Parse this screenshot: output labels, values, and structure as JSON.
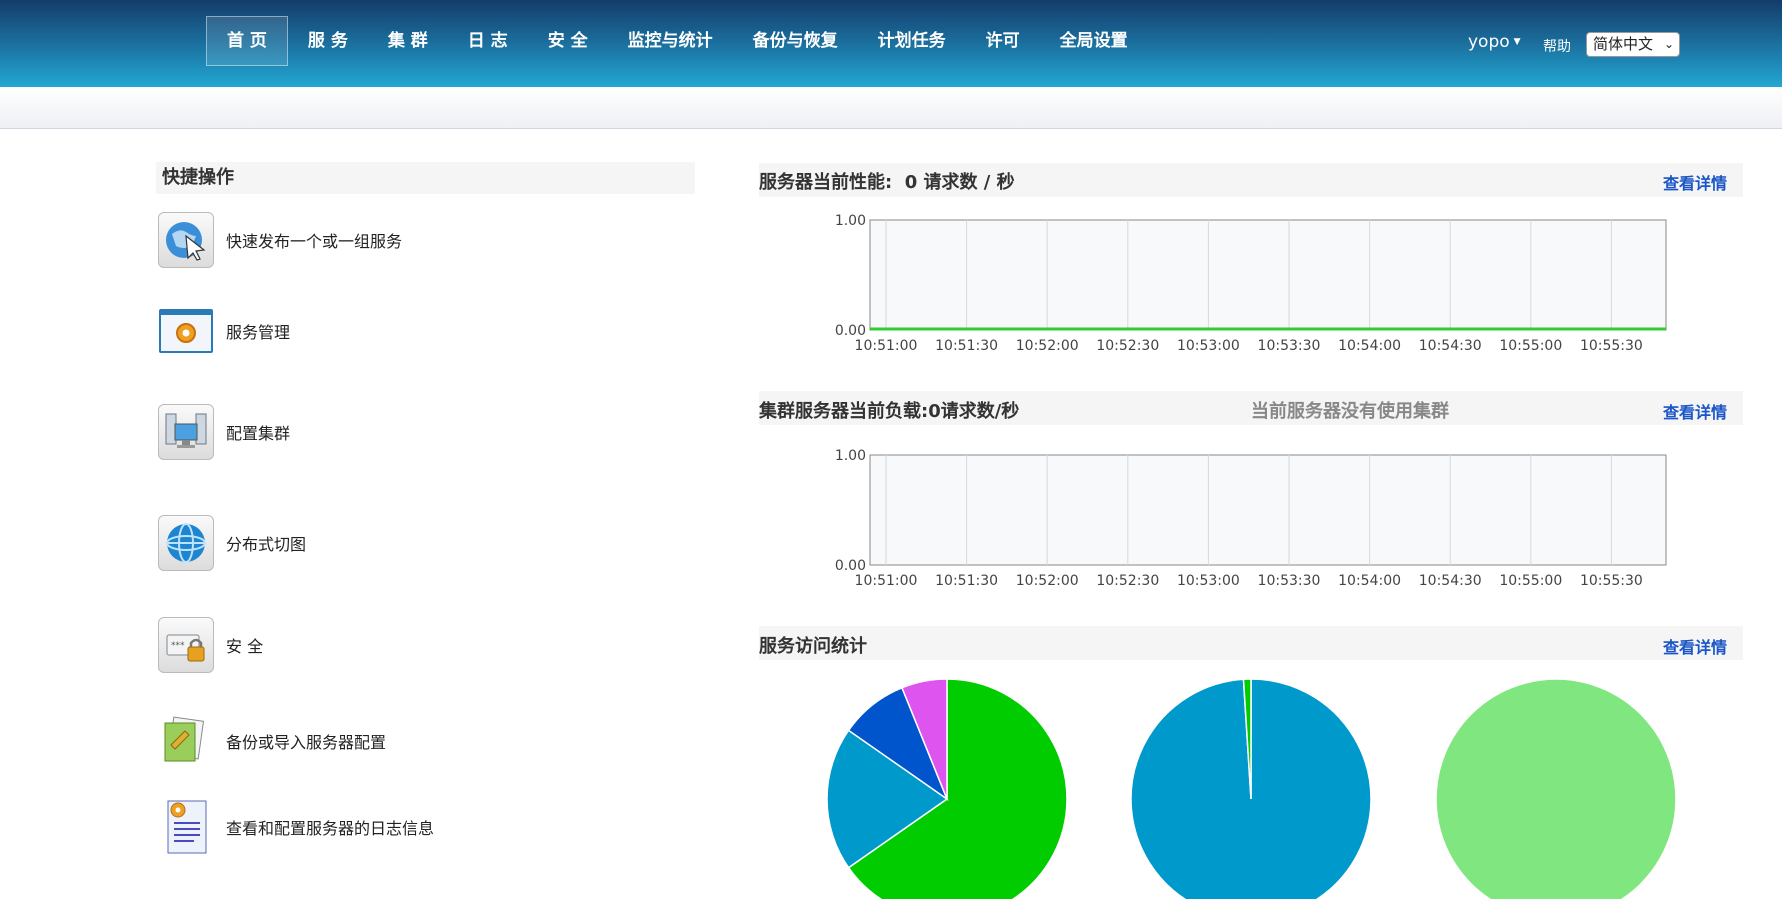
{
  "nav": {
    "items": [
      "首 页",
      "服 务",
      "集 群",
      "日 志",
      "安 全",
      "监控与统计",
      "备份与恢复",
      "计划任务",
      "许可",
      "全局设置"
    ],
    "active": 0
  },
  "header": {
    "user": "yopo",
    "help": "帮助",
    "language": "简体中文"
  },
  "quick_actions": {
    "title": "快捷操作",
    "items": [
      {
        "label": "快速发布一个或一组服务",
        "icon": "globe-cursor-icon"
      },
      {
        "label": "服务管理",
        "icon": "service-gear-icon"
      },
      {
        "label": "配置集群",
        "icon": "cluster-servers-icon"
      },
      {
        "label": "分布式切图",
        "icon": "globe-network-icon"
      },
      {
        "label": "安 全",
        "icon": "lock-icon"
      },
      {
        "label": "备份或导入服务器配置",
        "icon": "backup-tools-icon"
      },
      {
        "label": "查看和配置服务器的日志信息",
        "icon": "log-document-icon"
      }
    ]
  },
  "perf": {
    "title": "服务器当前性能:",
    "value": "0 请求数 / 秒",
    "details": "查看详情"
  },
  "cluster": {
    "title": "集群服务器当前负载:",
    "value": "0请求数/秒",
    "note": "当前服务器没有使用集群",
    "details": "查看详情"
  },
  "access": {
    "title": "服务访问统计",
    "details": "查看详情"
  },
  "chart_data": [
    {
      "type": "line",
      "x": [
        "10:51:00",
        "10:51:30",
        "10:52:00",
        "10:52:30",
        "10:53:00",
        "10:53:30",
        "10:54:00",
        "10:54:30",
        "10:55:00",
        "10:55:30"
      ],
      "series": [
        {
          "values": [
            0,
            0,
            0,
            0,
            0,
            0,
            0,
            0,
            0,
            0,
            0
          ],
          "color": "#33cc33"
        }
      ],
      "ylim": [
        0,
        1
      ],
      "yticks": [
        "1.00",
        "0.00"
      ],
      "grid": true
    },
    {
      "type": "line",
      "x": [
        "10:51:00",
        "10:51:30",
        "10:52:00",
        "10:52:30",
        "10:53:00",
        "10:53:30",
        "10:54:00",
        "10:54:30",
        "10:55:00",
        "10:55:30"
      ],
      "series": [],
      "ylim": [
        0,
        1
      ],
      "yticks": [
        "1.00",
        "0.00"
      ],
      "grid": true
    },
    {
      "type": "pie",
      "slices": [
        {
          "value": 64,
          "color": "#00cc00"
        },
        {
          "value": 19,
          "color": "#0099cc"
        },
        {
          "value": 9,
          "color": "#0055cc"
        },
        {
          "value": 6,
          "color": "#dd55ee"
        }
      ]
    },
    {
      "type": "pie",
      "slices": [
        {
          "value": 99,
          "color": "#0099cc"
        },
        {
          "value": 1,
          "color": "#00cc00"
        }
      ]
    },
    {
      "type": "pie",
      "slices": [
        {
          "value": 100,
          "color": "#80e680"
        }
      ]
    }
  ]
}
